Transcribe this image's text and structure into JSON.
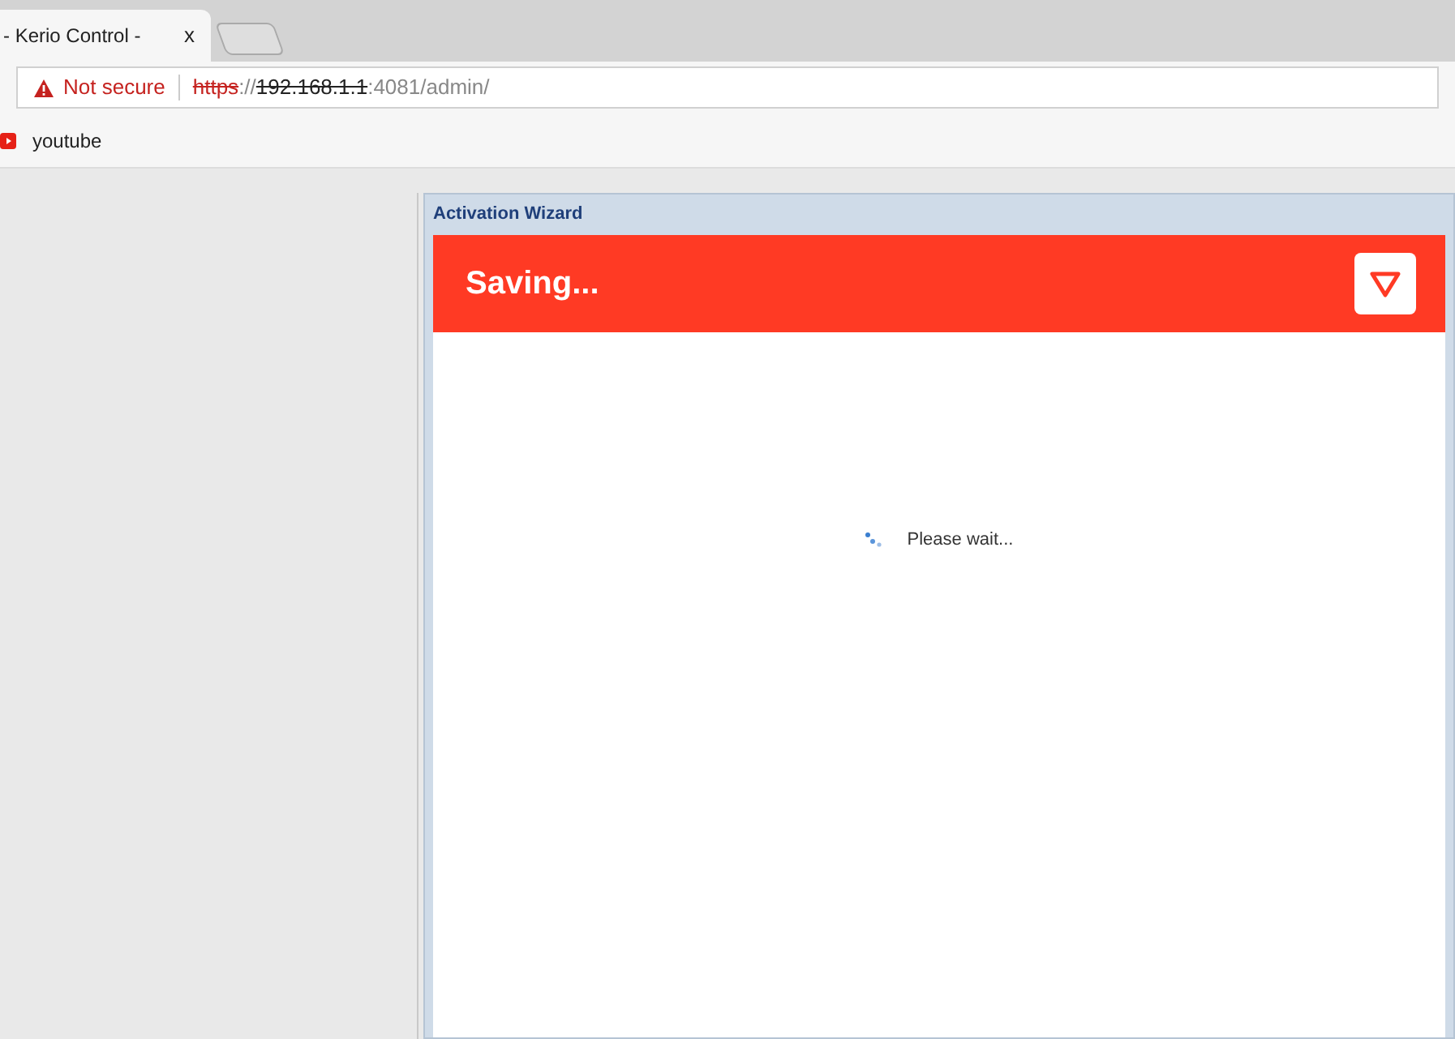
{
  "browser": {
    "tab": {
      "title": "- Kerio Control -",
      "close": "x",
      "selected": true
    },
    "address": {
      "security": "Not secure",
      "scheme": "https",
      "separator": "://",
      "host": "192.168.1.1",
      "rest": ":4081/admin/"
    },
    "bookmarks": [
      {
        "label": "youtube"
      }
    ]
  },
  "dialog": {
    "title": "Activation Wizard",
    "header": "Saving...",
    "status": "Please wait..."
  }
}
